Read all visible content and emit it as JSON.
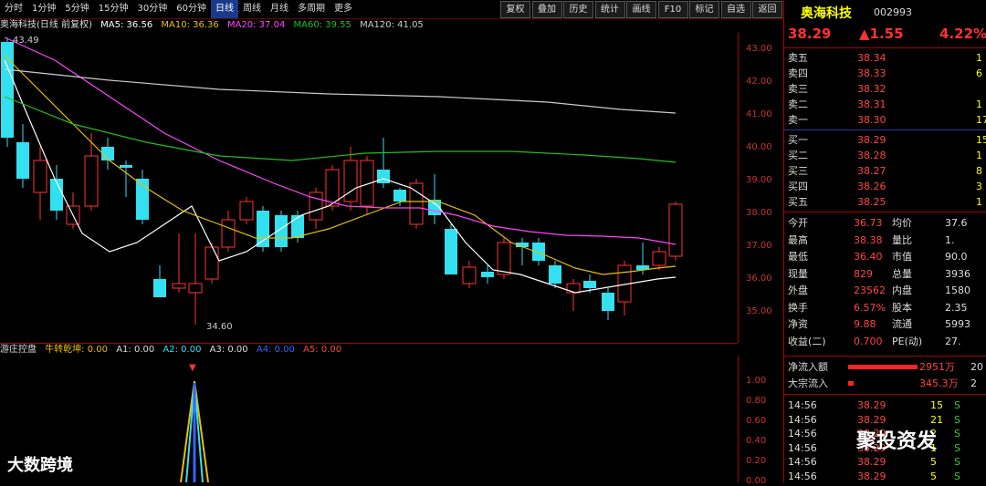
{
  "toolbar": {
    "periods": [
      "分时",
      "1分钟",
      "5分钟",
      "15分钟",
      "30分钟",
      "60分钟",
      "日线",
      "周线",
      "月线",
      "多周期",
      "更多"
    ],
    "active_period": "日线",
    "buttons": [
      "复权",
      "叠加",
      "历史",
      "统计",
      "画线",
      "F10",
      "标记",
      "自选",
      "返回"
    ]
  },
  "ma_line": {
    "title": "奥海科技(日线 前复权)",
    "ma5": "MA5: 36.56",
    "ma10": "MA10: 36.36",
    "ma20": "MA20: 37.04",
    "ma60": "MA60: 39.55",
    "ma120": "MA120: 41.05"
  },
  "price_axis": [
    "43.00",
    "42.00",
    "41.00",
    "40.00",
    "39.00",
    "38.00",
    "37.00",
    "36.00",
    "35.00"
  ],
  "annotations": {
    "high": "43.49",
    "low": "34.60"
  },
  "sub_indicator": {
    "name": "游庄控盘",
    "items": [
      "牛转乾坤: 0.00",
      "A1: 0.00",
      "A2: 0.00",
      "A3: 0.00",
      "A4: 0.00",
      "A5: 0.00"
    ],
    "axis": [
      "1.00",
      "0.80",
      "0.60",
      "0.40",
      "0.20",
      "0.00"
    ]
  },
  "stock": {
    "name": "奥海科技",
    "code": "002993",
    "price": "38.29",
    "change": "▲1.55",
    "change_pct": "4.22%"
  },
  "order_book": {
    "asks": [
      {
        "label": "卖五",
        "price": "38.34",
        "vol": "1"
      },
      {
        "label": "卖四",
        "price": "38.33",
        "vol": "6"
      },
      {
        "label": "卖三",
        "price": "38.32",
        "vol": ""
      },
      {
        "label": "卖二",
        "price": "38.31",
        "vol": "1"
      },
      {
        "label": "卖一",
        "price": "38.30",
        "vol": "17"
      }
    ],
    "bids": [
      {
        "label": "买一",
        "price": "38.29",
        "vol": "15"
      },
      {
        "label": "买二",
        "price": "38.28",
        "vol": "1"
      },
      {
        "label": "买三",
        "price": "38.27",
        "vol": "8"
      },
      {
        "label": "买四",
        "price": "38.26",
        "vol": "3"
      },
      {
        "label": "买五",
        "price": "38.25",
        "vol": "1"
      }
    ]
  },
  "stats": [
    {
      "l1": "今开",
      "v1": "36.73",
      "l2": "均价",
      "v2": "37.6"
    },
    {
      "l1": "最高",
      "v1": "38.38",
      "l2": "量比",
      "v2": "1."
    },
    {
      "l1": "最低",
      "v1": "36.40",
      "l2": "市值",
      "v2": "90.0"
    },
    {
      "l1": "现量",
      "v1": "829",
      "l2": "总量",
      "v2": "3936"
    },
    {
      "l1": "外盘",
      "v1": "23562",
      "l2": "内盘",
      "v2": "1580"
    },
    {
      "l1": "换手",
      "v1": "6.57%",
      "l2": "股本",
      "v2": "2.35"
    },
    {
      "l1": "净资",
      "v1": "9.88",
      "l2": "流通",
      "v2": "5993"
    },
    {
      "l1": "收益(二)",
      "v1": "0.700",
      "l2": "PE(动)",
      "v2": "27."
    }
  ],
  "flows": [
    {
      "label": "净流入额",
      "value": "2951万",
      "extra": "20"
    },
    {
      "label": "大宗流入",
      "value": "345.3万",
      "extra": "2"
    }
  ],
  "ticks": [
    {
      "time": "14:56",
      "price": "38.29",
      "vol": "15",
      "side": "S"
    },
    {
      "time": "14:56",
      "price": "38.29",
      "vol": "21",
      "side": "S"
    },
    {
      "time": "14:56",
      "price": "38.29",
      "vol": "2",
      "side": "S"
    },
    {
      "time": "14:56",
      "price": "38.29",
      "vol": "1",
      "side": "S"
    },
    {
      "time": "14:56",
      "price": "38.29",
      "vol": "5",
      "side": "S"
    },
    {
      "time": "14:56",
      "price": "38.29",
      "vol": "5",
      "side": "S"
    }
  ],
  "watermarks": {
    "left": "大数跨境",
    "right": "聚投资发"
  },
  "colors": {
    "up": "#ff3333",
    "down": "#33e0f0",
    "ma5": "#ffffff",
    "ma10": "#e8c000",
    "ma20": "#ff44ff",
    "ma60": "#20c020",
    "ma120": "#cccccc"
  }
}
